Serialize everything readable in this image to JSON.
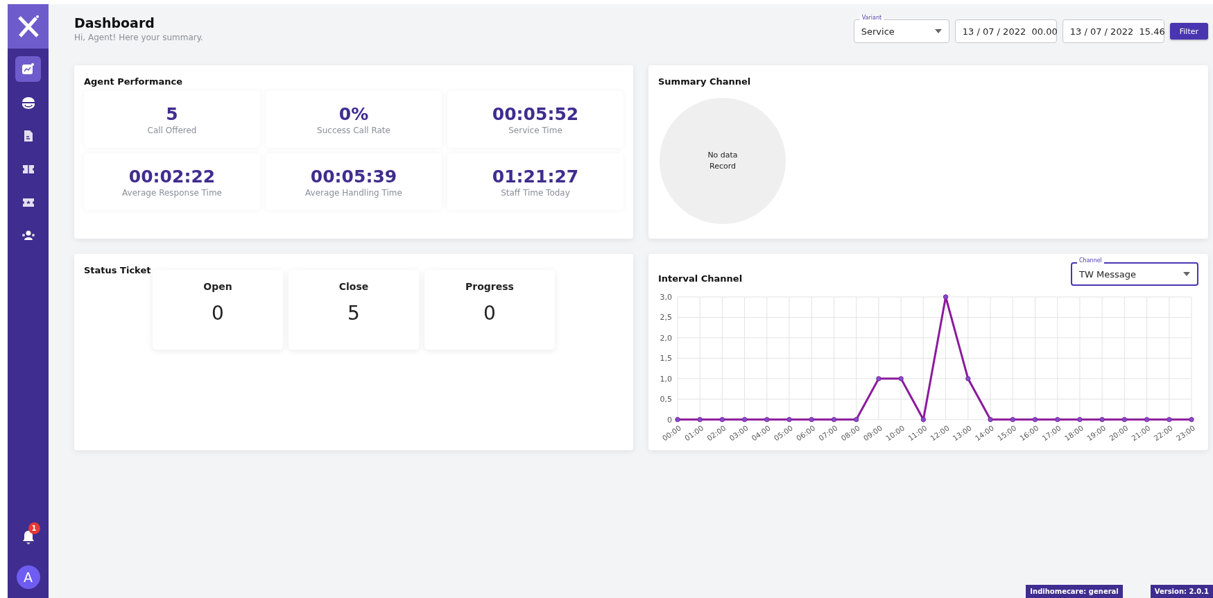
{
  "sidebar": {
    "items": [
      {
        "kind": "chart",
        "selected": true
      },
      {
        "kind": "inbox",
        "selected": false
      },
      {
        "kind": "document",
        "selected": false
      },
      {
        "kind": "ticket",
        "selected": false
      },
      {
        "kind": "star",
        "selected": false
      },
      {
        "kind": "team",
        "selected": false
      }
    ],
    "notification_badge": "1",
    "avatar": "A"
  },
  "header": {
    "title": "Dashboard",
    "subtitle": "Hi, Agent! Here your summary."
  },
  "filters": {
    "variant": {
      "label": "Variant",
      "value": "Service"
    },
    "date_from": "13 / 07 / 2022  00.00",
    "date_to": "13 / 07 / 2022  15.46",
    "button": "Filter"
  },
  "agent_performance": {
    "title": "Agent Performance",
    "stats": [
      {
        "value": "5",
        "label": "Call Offered"
      },
      {
        "value": "0%",
        "label": "Success Call Rate"
      },
      {
        "value": "00:05:52",
        "label": "Service Time"
      },
      {
        "value": "00:02:22",
        "label": "Average Response Time"
      },
      {
        "value": "00:05:39",
        "label": "Average Handling Time"
      },
      {
        "value": "01:21:27",
        "label": "Staff Time Today"
      }
    ]
  },
  "summary_channel": {
    "title": "Summary Channel",
    "empty_text_lines": [
      "No data",
      "Record"
    ]
  },
  "status_ticket": {
    "title": "Status Ticket",
    "items": [
      {
        "label": "Open",
        "value": "0"
      },
      {
        "label": "Close",
        "value": "5"
      },
      {
        "label": "Progress",
        "value": "0"
      }
    ]
  },
  "interval_channel": {
    "title": "Interval Channel",
    "channel_select": {
      "label": "Channel",
      "value": "TW Message"
    },
    "chart_data": {
      "type": "line",
      "categories": [
        "00:00",
        "01:00",
        "02:00",
        "03:00",
        "04:00",
        "05:00",
        "06:00",
        "07:00",
        "08:00",
        "09:00",
        "10:00",
        "11:00",
        "12:00",
        "13:00",
        "14:00",
        "15:00",
        "16:00",
        "17:00",
        "18:00",
        "19:00",
        "20:00",
        "21:00",
        "22:00",
        "23:00"
      ],
      "grid": true,
      "series": [
        {
          "color": "#8b1a9c",
          "marker": true,
          "values": [
            0,
            0,
            0,
            0,
            0,
            0,
            0,
            0,
            0,
            1,
            1,
            0,
            3,
            1,
            0,
            0,
            0,
            0,
            0,
            0,
            0,
            0,
            0,
            0
          ]
        }
      ],
      "ylim": [
        0,
        3
      ],
      "yticks": [
        {
          "value": 0,
          "label": "0"
        },
        {
          "value": 0.5,
          "label": "0,5"
        },
        {
          "value": 1,
          "label": "1,0"
        },
        {
          "value": 1.5,
          "label": "1,5"
        },
        {
          "value": 2,
          "label": "2,0"
        },
        {
          "value": 2.5,
          "label": "2,5"
        },
        {
          "value": 3,
          "label": "3,0"
        }
      ]
    }
  },
  "footer": {
    "tenant": "Indihomecare: general",
    "version": "Version: 2.0.1"
  }
}
